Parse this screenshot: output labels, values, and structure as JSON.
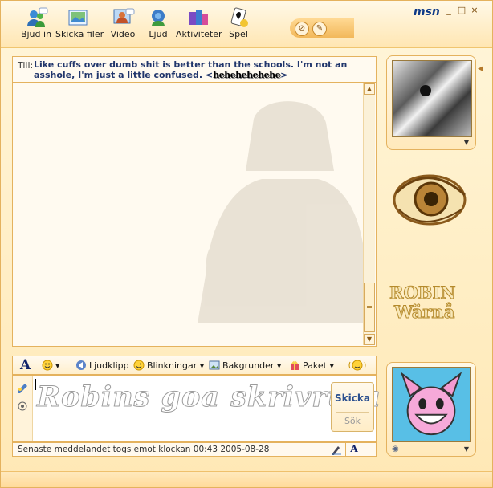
{
  "toolbar": {
    "items": [
      {
        "label": "Bjud in",
        "icon": "invite-people-icon"
      },
      {
        "label": "Skicka filer",
        "icon": "send-files-icon"
      },
      {
        "label": "Video",
        "icon": "video-icon"
      },
      {
        "label": "Ljud",
        "icon": "audio-icon"
      },
      {
        "label": "Aktiviteter",
        "icon": "activities-icon"
      },
      {
        "label": "Spel",
        "icon": "games-icon"
      }
    ],
    "brand": "msn",
    "window_controls": [
      "_",
      "□",
      "×"
    ]
  },
  "to": {
    "label": "Till:",
    "contact_text": "Like cuffs over dumb shit is better than the schools. I'm not an asshole, I'm just a little confused. <",
    "contact_nick": "hehehehehehe",
    "contact_end": ">"
  },
  "compose_toolbar": {
    "font": "A",
    "ljudklipp": "Ljudklipp",
    "blinkningar": "Blinkningar",
    "bakgrunder": "Bakgrunder",
    "paket": "Paket"
  },
  "compose": {
    "watermark": "Robins goa skrivruta",
    "send_label": "Skicka",
    "search_label": "Sök"
  },
  "status": {
    "text": "Senaste meddelandet togs emot klockan 00:43 2005-08-28",
    "font_button": "A"
  },
  "right": {
    "name_line1": "ROBIN",
    "name_line2": "Wärnå"
  },
  "colors": {
    "accent": "#e4b25e",
    "contact_text": "#21366c"
  }
}
